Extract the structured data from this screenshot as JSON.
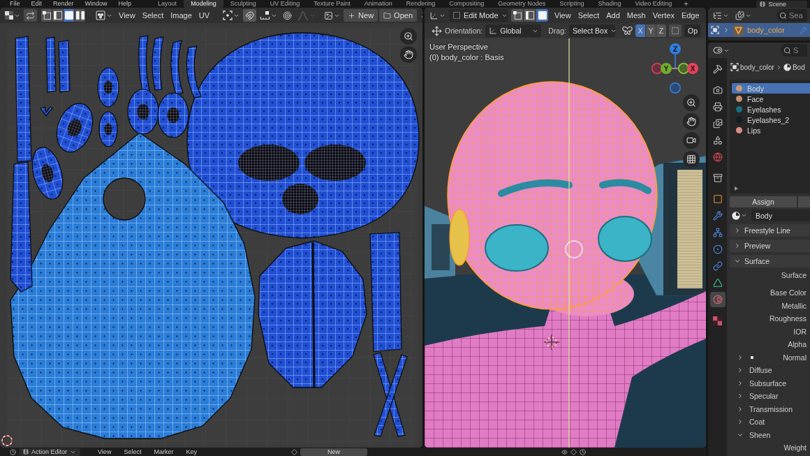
{
  "topbar": {
    "menus": [
      "File",
      "Edit",
      "Render",
      "Window",
      "Help"
    ],
    "workspaces": [
      {
        "label": "Layout",
        "selected": false
      },
      {
        "label": "Modeling",
        "selected": true
      },
      {
        "label": "Sculpting",
        "selected": false
      },
      {
        "label": "UV Editing",
        "selected": false
      },
      {
        "label": "Texture Paint",
        "selected": false
      },
      {
        "label": "Animation",
        "selected": false
      },
      {
        "label": "Rendering",
        "selected": false
      },
      {
        "label": "Compositing",
        "selected": false
      },
      {
        "label": "Geometry Nodes",
        "selected": false
      },
      {
        "label": "Scripting",
        "selected": false
      },
      {
        "label": "Shading",
        "selected": false
      },
      {
        "label": "Video Editing",
        "selected": false
      }
    ],
    "scene": "Scene"
  },
  "uv_editor": {
    "header": {
      "select_modes": [
        {
          "selected": false
        },
        {
          "selected": false
        },
        {
          "selected": true
        },
        {
          "selected": false
        }
      ],
      "menus": [
        "View",
        "Select",
        "Image",
        "UV"
      ],
      "snap": {
        "on": true
      },
      "falloff": {
        "disabled": true
      },
      "new_button": "New",
      "open_button": "Open"
    }
  },
  "viewport": {
    "header": {
      "mode": "Edit Mode",
      "select_modes": [
        {
          "selected": false
        },
        {
          "selected": false
        },
        {
          "selected": true
        }
      ],
      "menus": [
        "View",
        "Select",
        "Add",
        "Mesh",
        "Vertex",
        "Edge"
      ]
    },
    "tool_settings": {
      "orientation_label": "Orientation:",
      "orientation": "Global",
      "drag_label": "Drag:",
      "drag": "Select Box",
      "mirror_axes": [
        {
          "label": "X",
          "selected": true
        },
        {
          "label": "Y",
          "selected": false
        },
        {
          "label": "Z",
          "selected": false
        }
      ],
      "options": "Op"
    },
    "overlay": [
      "User Perspective",
      "(0) body_color : Basis"
    ],
    "gizmo": [
      "Z",
      "Y",
      "X"
    ]
  },
  "outliner": {
    "search": {
      "placeholder": "Sea"
    },
    "rows": [
      {
        "label": "body_color",
        "selected": true
      }
    ]
  },
  "properties": {
    "search": {
      "placeholder": "S"
    },
    "tabs": [
      {
        "selected": false
      },
      {
        "selected": false
      },
      {
        "selected": false
      },
      {
        "selected": false
      },
      {
        "selected": false
      },
      {
        "selected": false
      },
      {
        "selected": false
      },
      {
        "selected": false
      },
      {
        "selected": false
      },
      {
        "selected": false
      },
      {
        "selected": false
      },
      {
        "selected": false
      },
      {
        "selected": false
      },
      {
        "selected": true
      },
      {
        "selected": false
      }
    ],
    "breadcrumb": [
      "body_color",
      "Bod"
    ],
    "materials": [
      {
        "name": "Body",
        "color": "#c99a78",
        "selected": true
      },
      {
        "name": "Face",
        "color": "#c48f73",
        "selected": false
      },
      {
        "name": "Eyelashes",
        "color": "#1a6f80",
        "selected": false
      },
      {
        "name": "Eyelashes_2",
        "color": "#0e1d26",
        "selected": false
      },
      {
        "name": "Lips",
        "color": "#d98d87",
        "selected": false
      }
    ],
    "assign_button": "Assign",
    "material_name": "Body",
    "panels": [
      {
        "label": "Freestyle Line",
        "expanded": false
      },
      {
        "label": "Preview",
        "expanded": false
      },
      {
        "label": "Surface",
        "expanded": true,
        "children": [
          {
            "kind": "shader",
            "label": "Surface"
          },
          {
            "kind": "field",
            "label": "Base Color"
          },
          {
            "kind": "field",
            "label": "Metallic"
          },
          {
            "kind": "field",
            "label": "Roughness"
          },
          {
            "kind": "field",
            "label": "IOR"
          },
          {
            "kind": "field",
            "label": "Alpha"
          },
          {
            "kind": "input",
            "label": "Normal",
            "expanded": false
          },
          {
            "kind": "subpanel",
            "label": "Diffuse",
            "expanded": false
          },
          {
            "kind": "subpanel",
            "label": "Subsurface",
            "expanded": false
          },
          {
            "kind": "subpanel",
            "label": "Specular",
            "expanded": false
          },
          {
            "kind": "subpanel",
            "label": "Transmission",
            "expanded": false
          },
          {
            "kind": "subpanel",
            "label": "Coat",
            "expanded": false
          },
          {
            "kind": "subpanel",
            "label": "Sheen",
            "expanded": true,
            "children": [
              {
                "kind": "field",
                "label": "Weight"
              }
            ]
          }
        ]
      }
    ]
  },
  "bottom_bar": {
    "editor": "Action Editor",
    "menus": [
      "View",
      "Select",
      "Marker",
      "Key"
    ],
    "new_button": "New"
  }
}
